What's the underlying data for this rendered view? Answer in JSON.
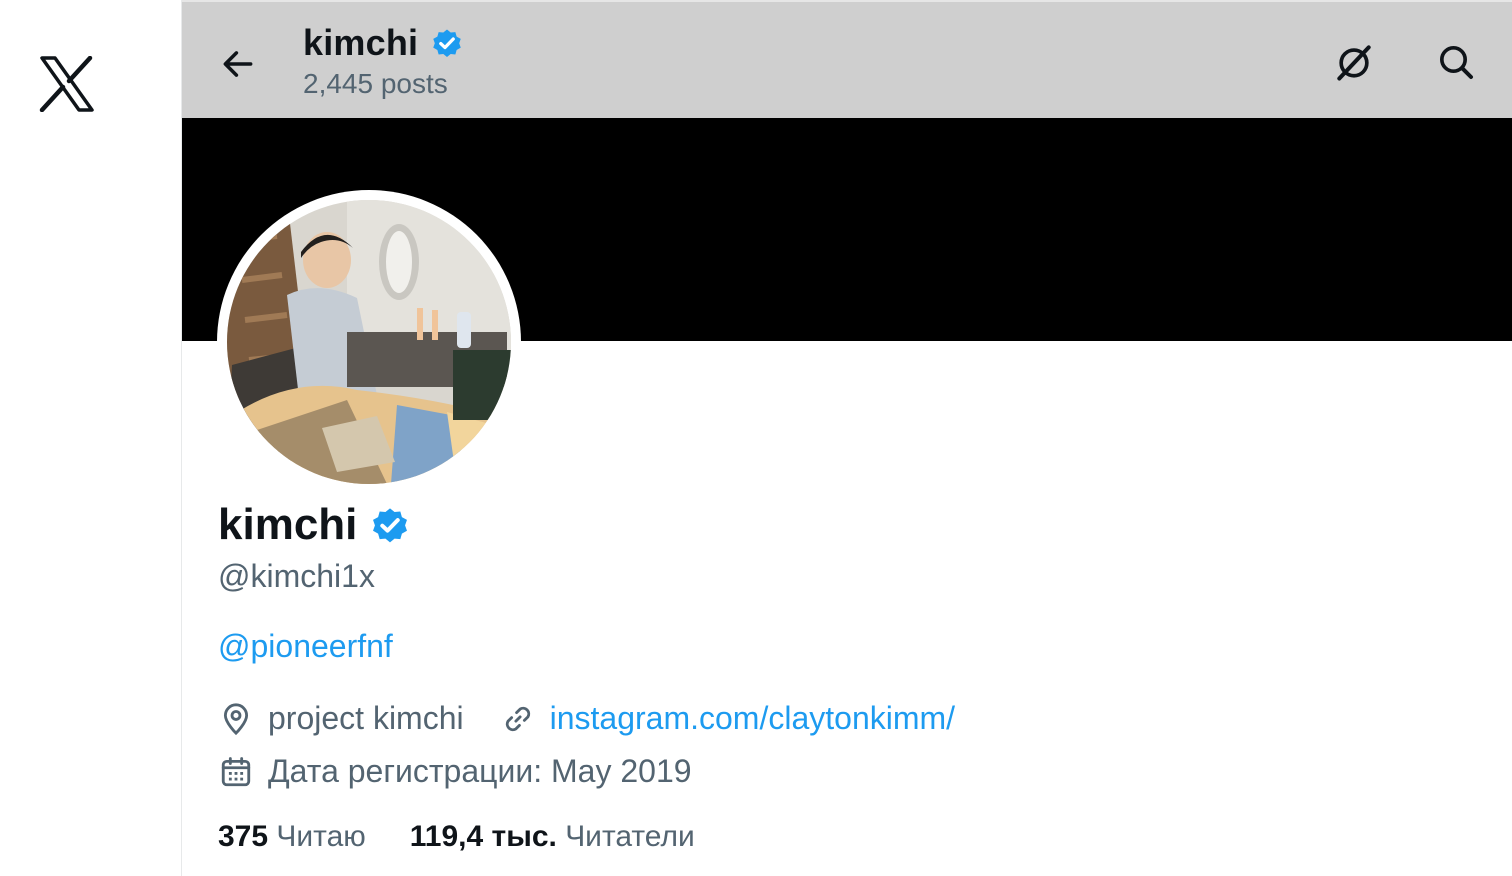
{
  "header": {
    "name": "kimchi",
    "posts_count": "2,445 posts"
  },
  "profile": {
    "display_name": "kimchi",
    "handle": "@kimchi1x",
    "bio_mention": "@pioneerfnf",
    "location": "project kimchi",
    "website": "instagram.com/claytonkimm/",
    "joined": "Дата регистрации: May 2019",
    "following_count": "375",
    "following_label": "Читаю",
    "followers_count": "119,4 тыс.",
    "followers_label": "Читатели"
  },
  "icons": {
    "logo": "x-logo-icon",
    "back": "arrow-left-icon",
    "grok": "grok-icon",
    "search": "search-icon",
    "verified": "verified-badge-icon",
    "location": "location-pin-icon",
    "link": "link-icon",
    "calendar": "calendar-icon"
  },
  "colors": {
    "accent": "#1d9bf0",
    "header_bg": "#cfcfcf",
    "banner": "#000000",
    "secondary_text": "#536471",
    "primary_text": "#0f1419"
  }
}
